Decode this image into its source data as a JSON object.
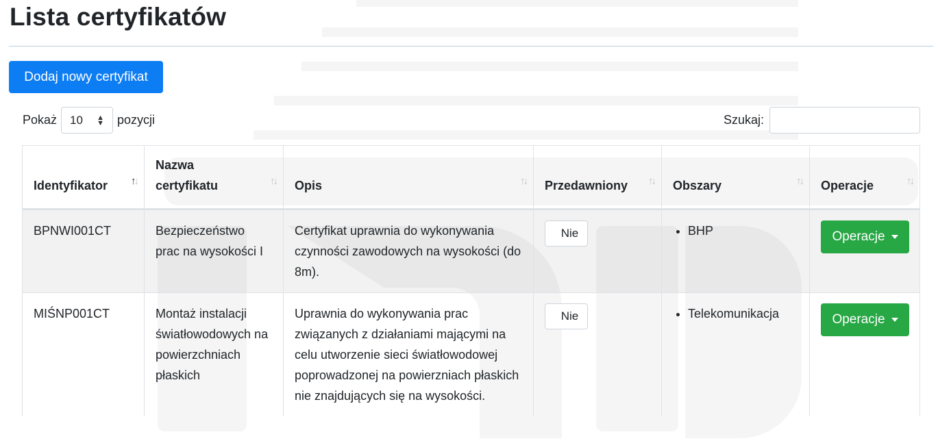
{
  "page": {
    "title": "Lista certyfikatów",
    "add_button": "Dodaj nowy certyfikat"
  },
  "length": {
    "prefix": "Pokaż",
    "value": "10",
    "suffix": "pozycji"
  },
  "search": {
    "label": "Szukaj:",
    "value": ""
  },
  "table": {
    "columns": [
      {
        "label": "Identyfikator",
        "sort": "asc"
      },
      {
        "label": "Nazwa certyfikatu",
        "sort": "none"
      },
      {
        "label": "Opis",
        "sort": "none"
      },
      {
        "label": "Przedawniony",
        "sort": "none"
      },
      {
        "label": "Obszary",
        "sort": "none"
      },
      {
        "label": "Operacje",
        "sort": "none"
      }
    ],
    "rows": [
      {
        "id": "BPNWI001CT",
        "name": "Bezpieczeństwo prac na wysokości I",
        "description": "Certyfikat uprawnia do wykonywania czynności zawodowych na wysokości (do 8m).",
        "expired": "Nie",
        "areas": [
          "BHP"
        ],
        "operations": "Operacje"
      },
      {
        "id": "MIŚNP001CT",
        "name": "Montaż instalacji światłowodowych na powierzchniach płaskich",
        "description": "Uprawnia do wykonywania prac związanych z działaniami mającymi na celu utworzenie sieci światłowodowej poprowadzonej na powierzniach płaskich nie znajdujących się na wysokości.",
        "expired": "Nie",
        "areas": [
          "Telekomunikacja"
        ],
        "operations": "Operacje"
      }
    ]
  },
  "colors": {
    "primary": "#0d7df4",
    "success": "#28a745",
    "stripe": "#f2f2f2",
    "border": "#dee2e6"
  }
}
